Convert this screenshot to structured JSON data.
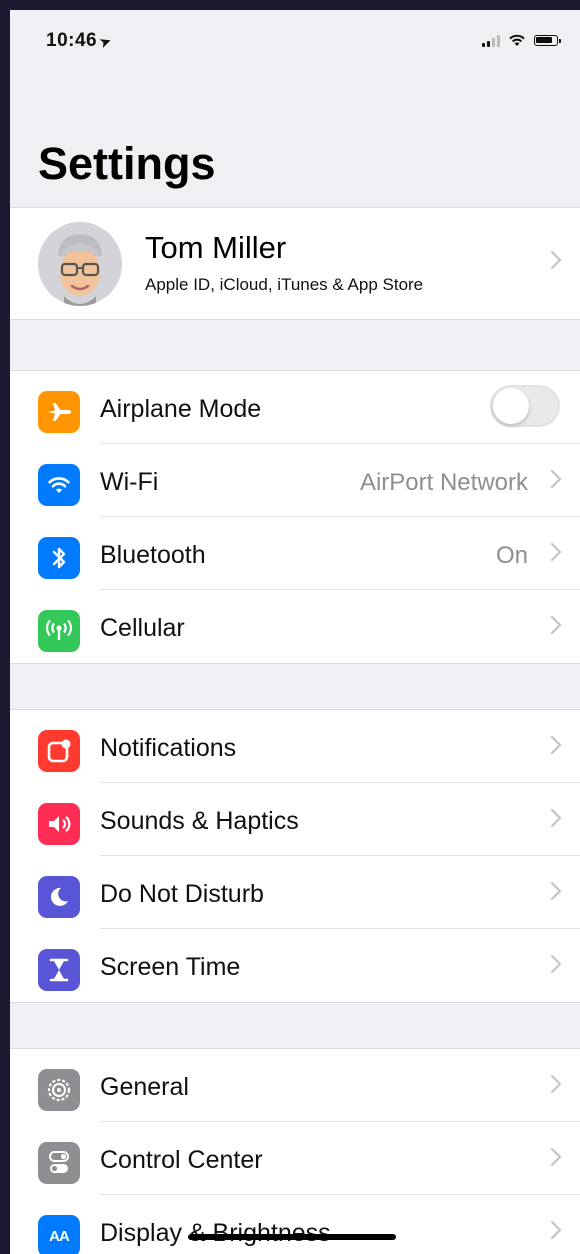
{
  "status_bar": {
    "time": "10:46",
    "location_icon": "location-arrow-icon",
    "signal_icon": "cellular-signal-icon",
    "wifi_icon": "wifi-icon",
    "battery_icon": "battery-icon"
  },
  "title": "Settings",
  "profile": {
    "name": "Tom Miller",
    "subtitle": "Apple ID, iCloud, iTunes & App Store",
    "avatar_icon": "memoji-avatar"
  },
  "groups": [
    {
      "rows": [
        {
          "label": "Airplane Mode",
          "icon": "airplane-icon",
          "color": "#ff9500",
          "toggle": false
        },
        {
          "label": "Wi-Fi",
          "icon": "wifi-icon",
          "color": "#007aff",
          "value": "AirPort Network"
        },
        {
          "label": "Bluetooth",
          "icon": "bluetooth-icon",
          "color": "#007aff",
          "value": "On"
        },
        {
          "label": "Cellular",
          "icon": "cellular-antenna-icon",
          "color": "#34c759"
        }
      ]
    },
    {
      "rows": [
        {
          "label": "Notifications",
          "icon": "notifications-icon",
          "color": "#ff3b30"
        },
        {
          "label": "Sounds & Haptics",
          "icon": "speaker-icon",
          "color": "#ff2d55"
        },
        {
          "label": "Do Not Disturb",
          "icon": "moon-icon",
          "color": "#5856d6"
        },
        {
          "label": "Screen Time",
          "icon": "hourglass-icon",
          "color": "#5856d6"
        }
      ]
    },
    {
      "rows": [
        {
          "label": "General",
          "icon": "gear-icon",
          "color": "#8e8e93"
        },
        {
          "label": "Control Center",
          "icon": "switches-icon",
          "color": "#8e8e93"
        },
        {
          "label": "Display & Brightness",
          "icon": "text-size-icon",
          "color": "#007aff",
          "glyph": "AA"
        }
      ]
    }
  ]
}
